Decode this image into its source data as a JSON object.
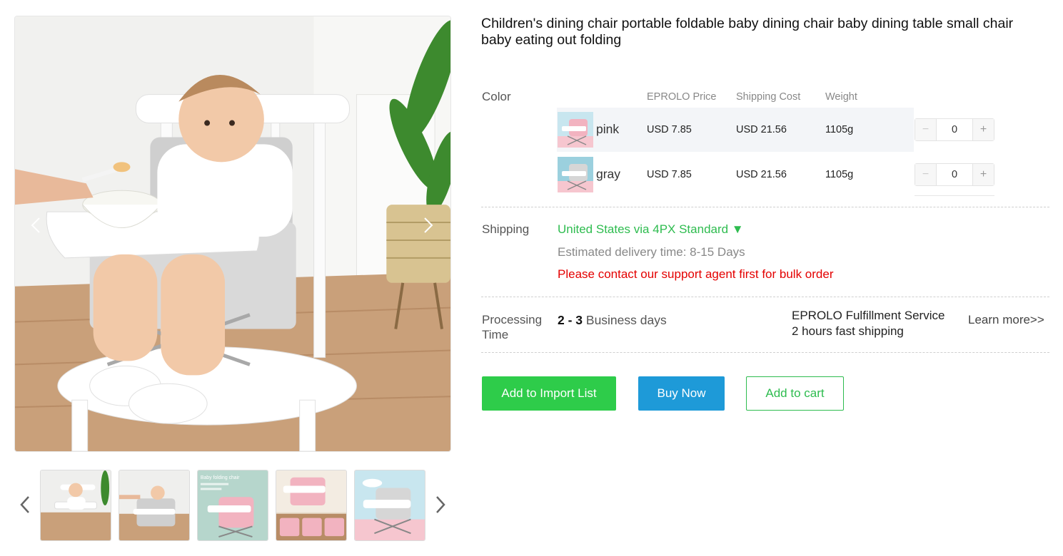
{
  "product": {
    "title": "Children's dining chair portable foldable baby dining chair baby dining table small chair baby eating out folding"
  },
  "variants": {
    "label": "Color",
    "headers": {
      "price": "EPROLO Price",
      "shipping": "Shipping Cost",
      "weight": "Weight"
    },
    "rows": [
      {
        "name": "pink",
        "price": "USD 7.85",
        "shipping": "USD 21.56",
        "weight": "1105g",
        "qty": "0",
        "minus": "−",
        "plus": "+"
      },
      {
        "name": "gray",
        "price": "USD 7.85",
        "shipping": "USD 21.56",
        "weight": "1105g",
        "qty": "0",
        "minus": "−",
        "plus": "+"
      }
    ]
  },
  "shipping": {
    "label": "Shipping",
    "method": "United States via 4PX Standard ▼",
    "eta": "Estimated delivery time: 8-15 Days",
    "warning": "Please contact our support agent first for bulk order"
  },
  "processing": {
    "label_line1": "Processing",
    "label_line2": "Time",
    "days_bold": "2 - 3",
    "days_rest": " Business days",
    "service_line1": "EPROLO Fulfillment Service",
    "service_line2": "2 hours fast shipping",
    "learn_more": "Learn more>>"
  },
  "actions": {
    "import": "Add to Import List",
    "buy": "Buy Now",
    "cart": "Add to cart"
  },
  "thumb_texts": {
    "t3_title": "Baby folding chair"
  },
  "colors": {
    "green": "#2ecc4a",
    "blue": "#1e9ad8",
    "red": "#e40000",
    "pink_chair": "#f2b3c0",
    "gray_chair": "#d6d6d6"
  },
  "icons": {
    "gallery_prev": "chevron-left-icon",
    "gallery_next": "chevron-right-icon"
  }
}
